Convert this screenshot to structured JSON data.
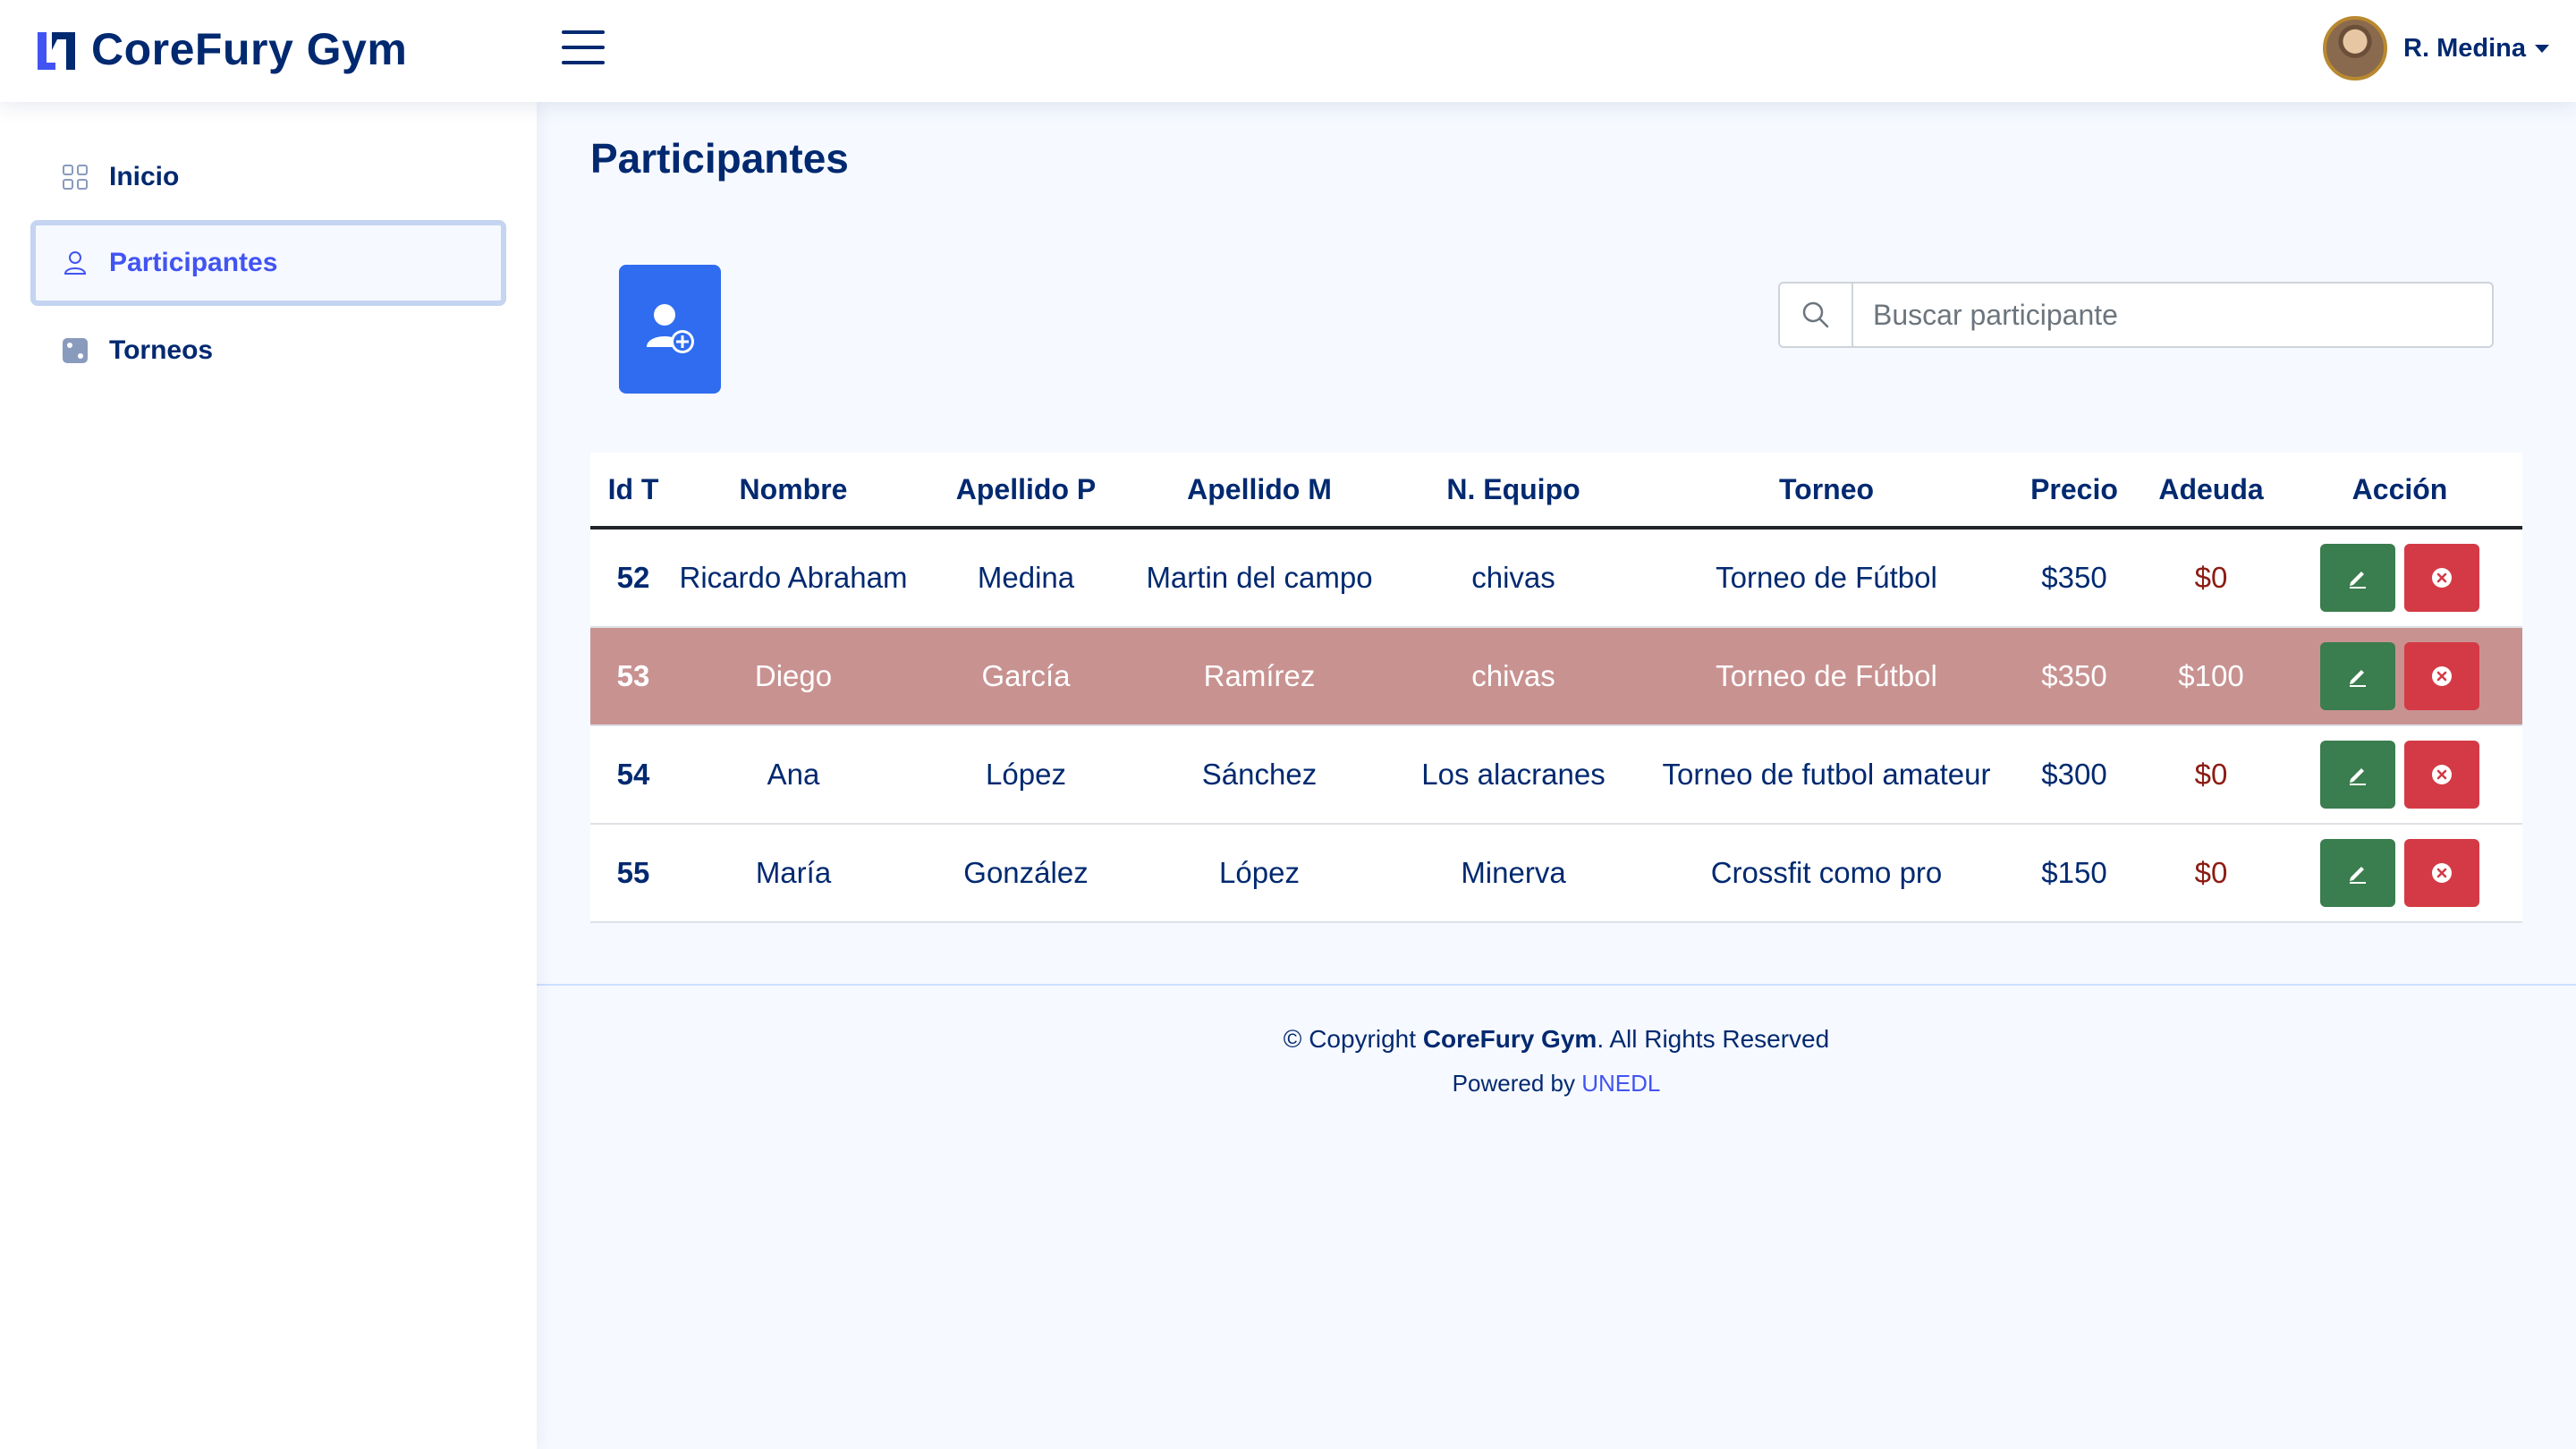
{
  "brand": {
    "name": "CoreFury Gym"
  },
  "user": {
    "name": "R. Medina"
  },
  "sidebar": {
    "items": [
      {
        "label": "Inicio",
        "icon": "grid-icon"
      },
      {
        "label": "Participantes",
        "icon": "person-icon",
        "active": true
      },
      {
        "label": "Torneos",
        "icon": "dice-icon"
      }
    ]
  },
  "main": {
    "title": "Participantes",
    "search": {
      "placeholder": "Buscar participante",
      "value": ""
    }
  },
  "table": {
    "headers": [
      "Id T",
      "Nombre",
      "Apellido P",
      "Apellido M",
      "N. Equipo",
      "Torneo",
      "Precio",
      "Adeuda",
      "Acción"
    ],
    "rows": [
      {
        "id": "52",
        "nombre": "Ricardo Abraham",
        "apellido_p": "Medina",
        "apellido_m": "Martin del campo",
        "equipo": "chivas",
        "torneo": "Torneo de Fútbol",
        "precio": "$350",
        "adeuda": "$0"
      },
      {
        "id": "53",
        "nombre": "Diego",
        "apellido_p": "García",
        "apellido_m": "Ramírez",
        "equipo": "chivas",
        "torneo": "Torneo de Fútbol",
        "precio": "$350",
        "adeuda": "$100"
      },
      {
        "id": "54",
        "nombre": "Ana",
        "apellido_p": "López",
        "apellido_m": "Sánchez",
        "equipo": "Los alacranes",
        "torneo": "Torneo de futbol amateur",
        "precio": "$300",
        "adeuda": "$0"
      },
      {
        "id": "55",
        "nombre": "María",
        "apellido_p": "González",
        "apellido_m": "López",
        "equipo": "Minerva",
        "torneo": "Crossfit como pro",
        "precio": "$150",
        "adeuda": "$0"
      }
    ]
  },
  "footer": {
    "copyright_prefix": "© Copyright ",
    "copyright_brand": "CoreFury Gym",
    "copyright_suffix": ". All Rights Reserved",
    "powered_prefix": "Powered by ",
    "powered_link": "UNEDL"
  },
  "colors": {
    "navy": "#012970",
    "accent": "#4154f1",
    "add_button": "#2f6cf0",
    "edit_button": "#3a7d4e",
    "delete_button": "#d43a45",
    "debt_row": "#c89291"
  }
}
